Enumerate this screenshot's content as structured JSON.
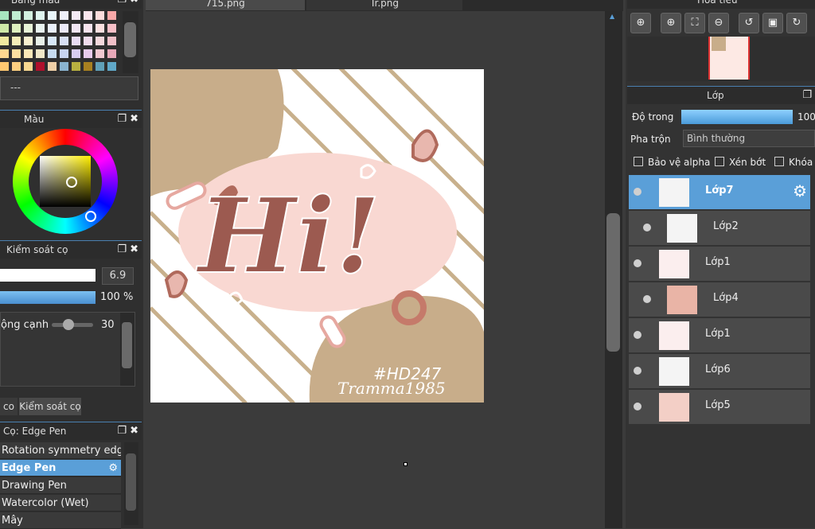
{
  "tabs": [
    {
      "label": "715.png"
    },
    {
      "label": "Tr.png"
    }
  ],
  "palette_panel": {
    "title": "Bảng màu",
    "field_value": "---"
  },
  "color_panel": {
    "title": "Màu"
  },
  "brush_control": {
    "title": "Kiểm soát cọ",
    "size_value": "6.9",
    "opacity_value": "100 %",
    "edge_label": "ộng cạnh",
    "edge_value": "30"
  },
  "bottom_tabs": [
    {
      "label": "co"
    },
    {
      "label": "Kiểm soát cọ"
    }
  ],
  "brush_panel": {
    "title": "Cọ: Edge Pen",
    "items": [
      {
        "label": "Rotation symmetry edge"
      },
      {
        "label": "Edge Pen"
      },
      {
        "label": "Drawing Pen"
      },
      {
        "label": "Watercolor (Wet)"
      },
      {
        "label": "Mây"
      }
    ]
  },
  "canvas_art": {
    "headline": "Hi!",
    "tag": "#HD247",
    "signature": "Tramma1985"
  },
  "navigator": {
    "title": "Hoa tiêu"
  },
  "layers_panel": {
    "title": "Lớp",
    "opacity_label": "Độ trong",
    "opacity_value": "100",
    "opacity_level": 1.0,
    "blend_label": "Pha trộn",
    "blend_value": "Bình thường",
    "protect_alpha": "Bảo vệ alpha",
    "clipping": "Xén bớt",
    "lock": "Khóa",
    "layers": [
      {
        "name": "Lớp7",
        "selected": true
      },
      {
        "name": "Lớp2"
      },
      {
        "name": "Lớp1"
      },
      {
        "name": "Lớp4"
      },
      {
        "name": "Lớp1"
      },
      {
        "name": "Lớp6"
      },
      {
        "name": "Lớp5"
      }
    ]
  },
  "colors": {
    "accent": "#5a9fd8",
    "bg": "#3b3b3b",
    "panel": "#2c2c2c"
  }
}
